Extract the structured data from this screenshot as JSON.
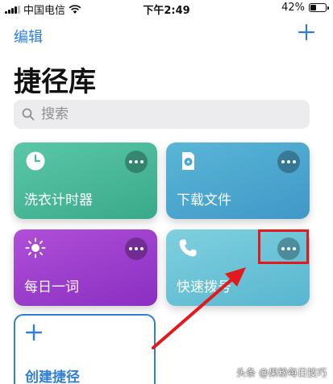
{
  "status_bar": {
    "carrier": "中国电信",
    "time": "下午2:49",
    "battery": "42%",
    "battery_level": 0.42,
    "icons": [
      "signal-icon",
      "wifi-icon",
      "battery-icon"
    ]
  },
  "nav": {
    "edit_label": "编辑",
    "add_icon": "plus-icon"
  },
  "page_title": "捷径库",
  "search": {
    "placeholder": "搜索",
    "icon": "search-icon"
  },
  "shortcuts": [
    {
      "label": "洗衣计时器",
      "icon": "clock-icon",
      "color": "#4dbb9a"
    },
    {
      "label": "下载文件",
      "icon": "document-icon",
      "color": "#4aa7cf"
    },
    {
      "label": "每日一词",
      "icon": "sun-icon",
      "color": "#9c3ccc"
    },
    {
      "label": "快速拨号",
      "icon": "phone-icon",
      "color": "#6cc3d8"
    }
  ],
  "more_icon": "ellipsis-icon",
  "create": {
    "label": "创建捷径",
    "icon": "plus-icon"
  },
  "annotation": {
    "color": "#e3191c"
  },
  "watermark": "头条 @果粉每日技巧",
  "colors": {
    "accent": "#2f7fd6",
    "annotation": "#e3191c"
  }
}
